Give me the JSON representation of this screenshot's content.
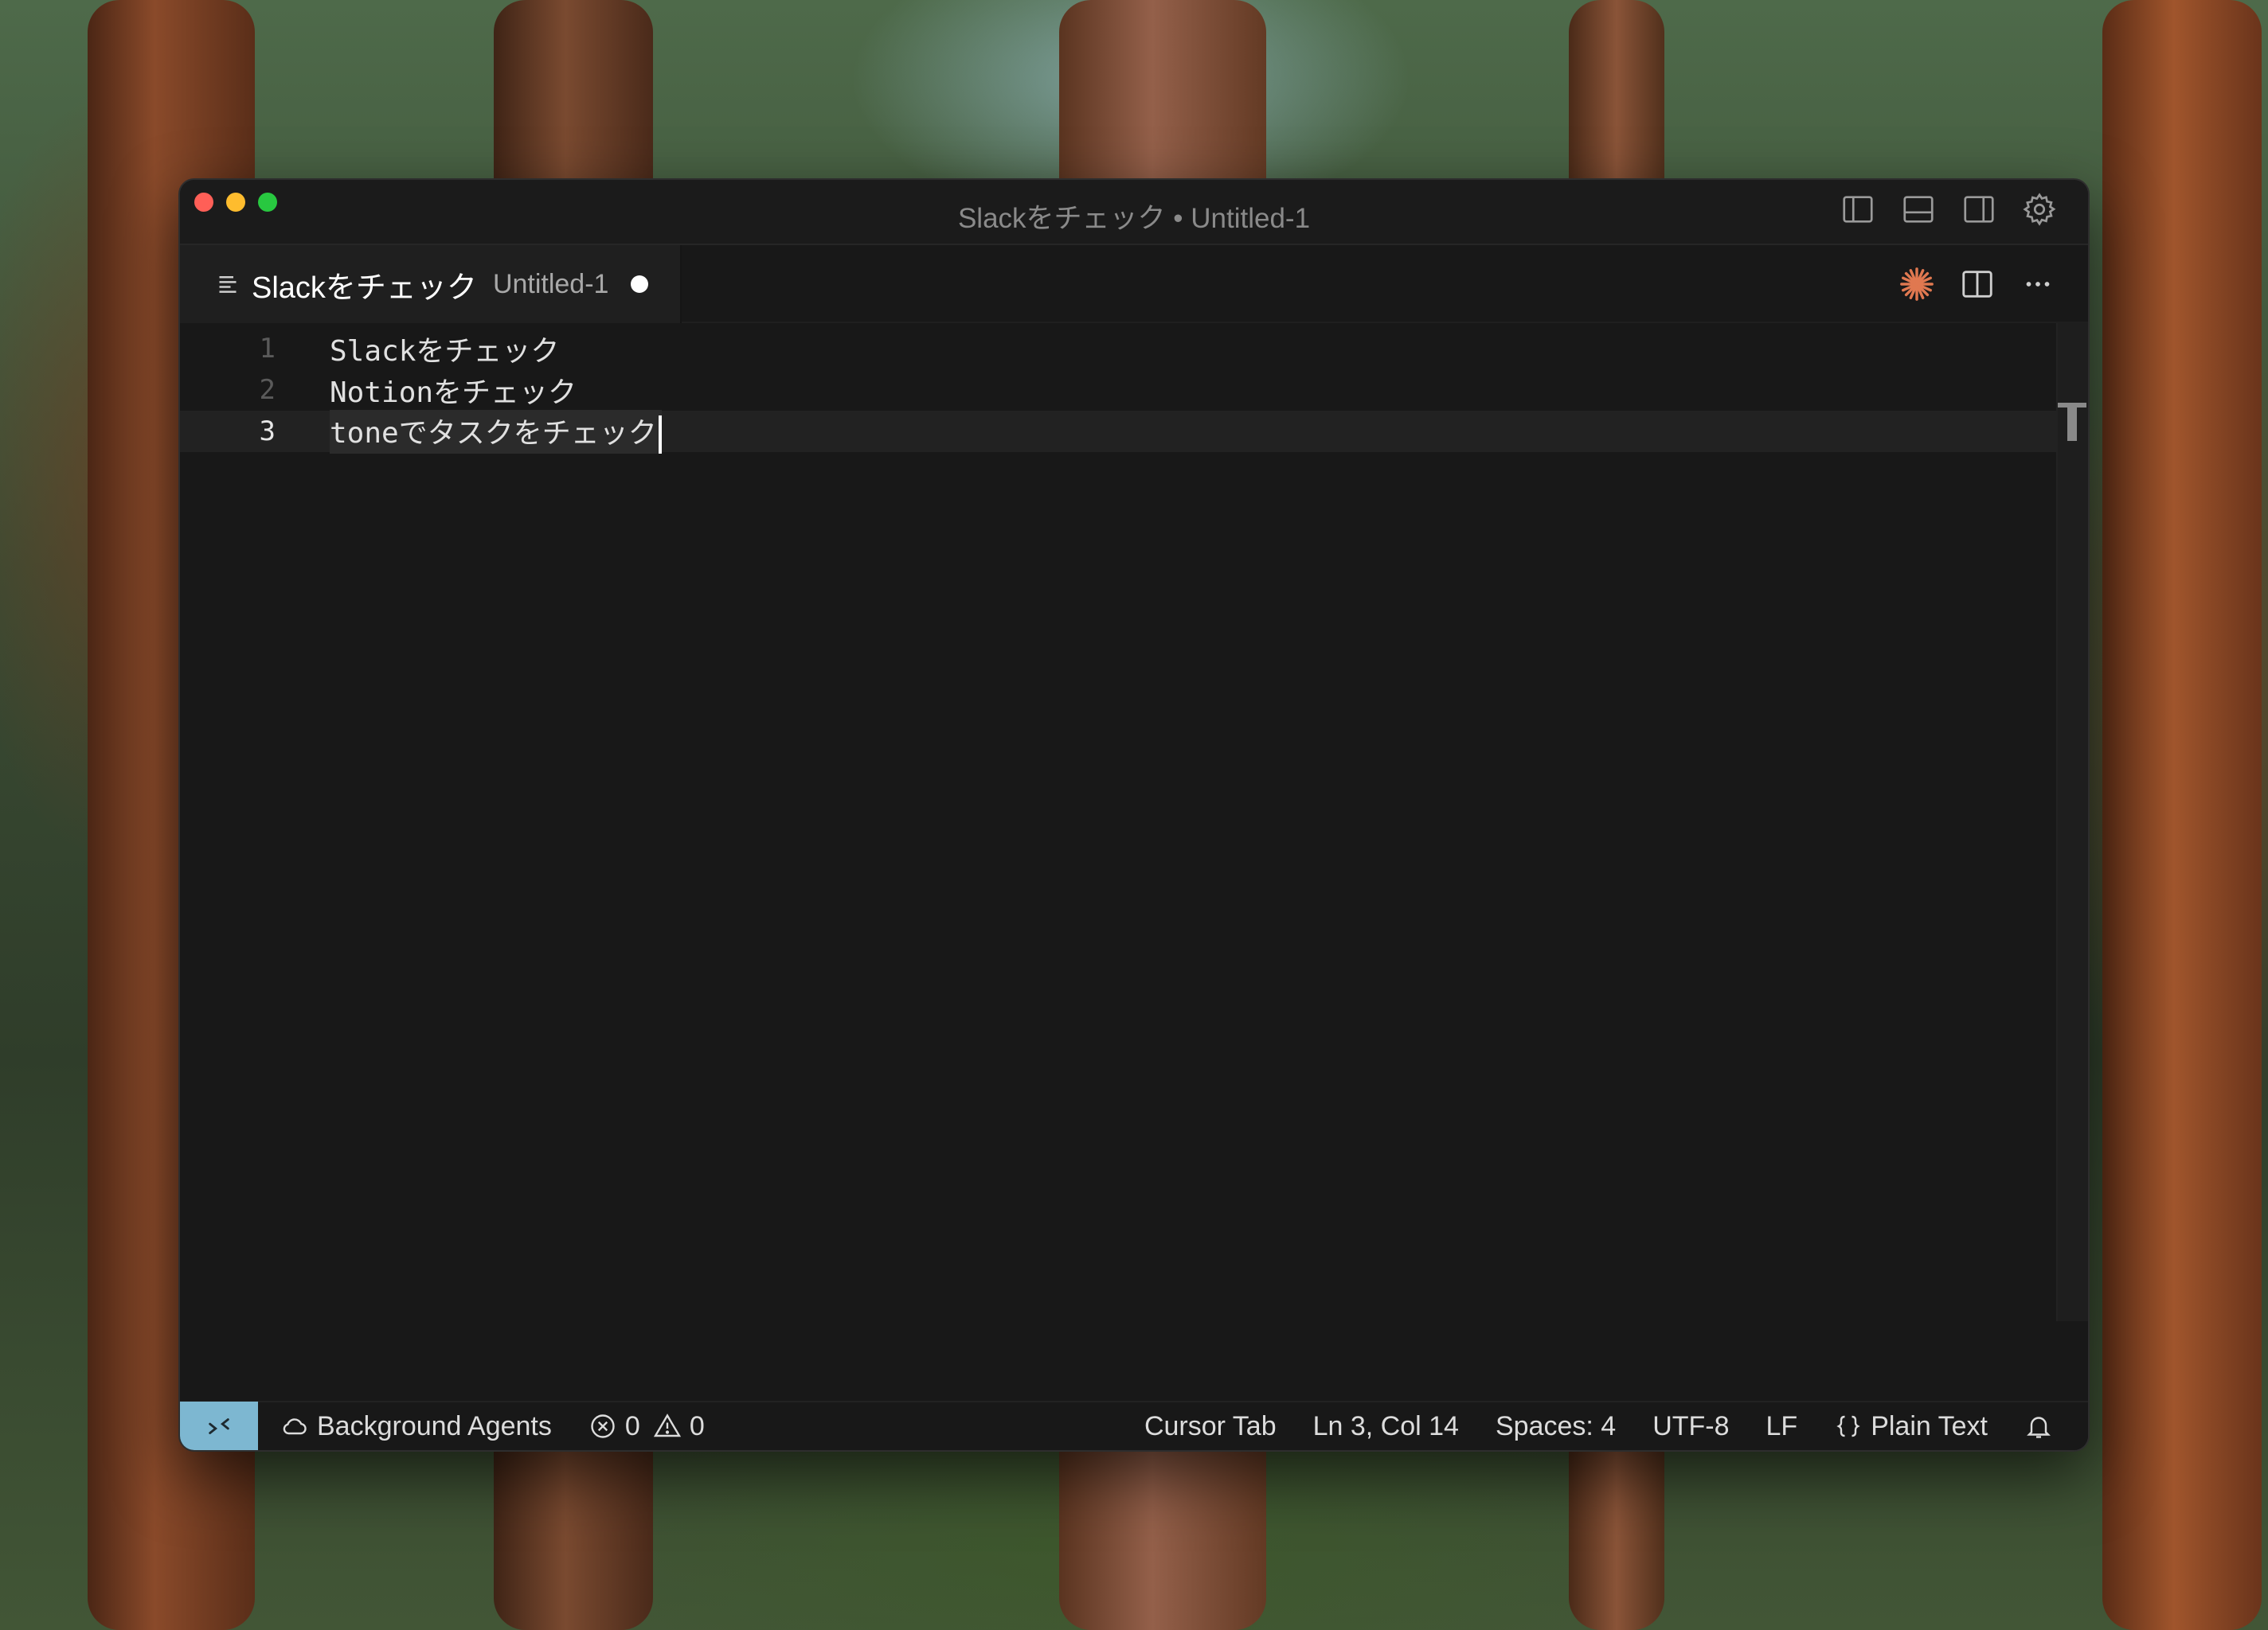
{
  "window": {
    "title": "Slackをチェック • Untitled-1"
  },
  "tab": {
    "title": "Slackをチェック",
    "description": "Untitled-1",
    "icon": "text-lines-icon",
    "dirty": true
  },
  "editor": {
    "lines": [
      {
        "number": "1",
        "text": "Slackをチェック"
      },
      {
        "number": "2",
        "text": "Notionをチェック"
      },
      {
        "number": "3",
        "text": "toneでタスクをチェック"
      }
    ],
    "current_line": 3
  },
  "statusbar": {
    "background_agents": "Background Agents",
    "errors": "0",
    "warnings": "0",
    "cursor_tab": "Cursor Tab",
    "position": "Ln 3, Col 14",
    "spaces": "Spaces: 4",
    "encoding": "UTF-8",
    "eol": "LF",
    "language": "Plain Text"
  },
  "colors": {
    "remote_indicator": "#7db7d1",
    "ai_icon": "#e07850",
    "close": "#ff5f57",
    "minimize": "#febc2e",
    "maximize": "#28c840"
  }
}
